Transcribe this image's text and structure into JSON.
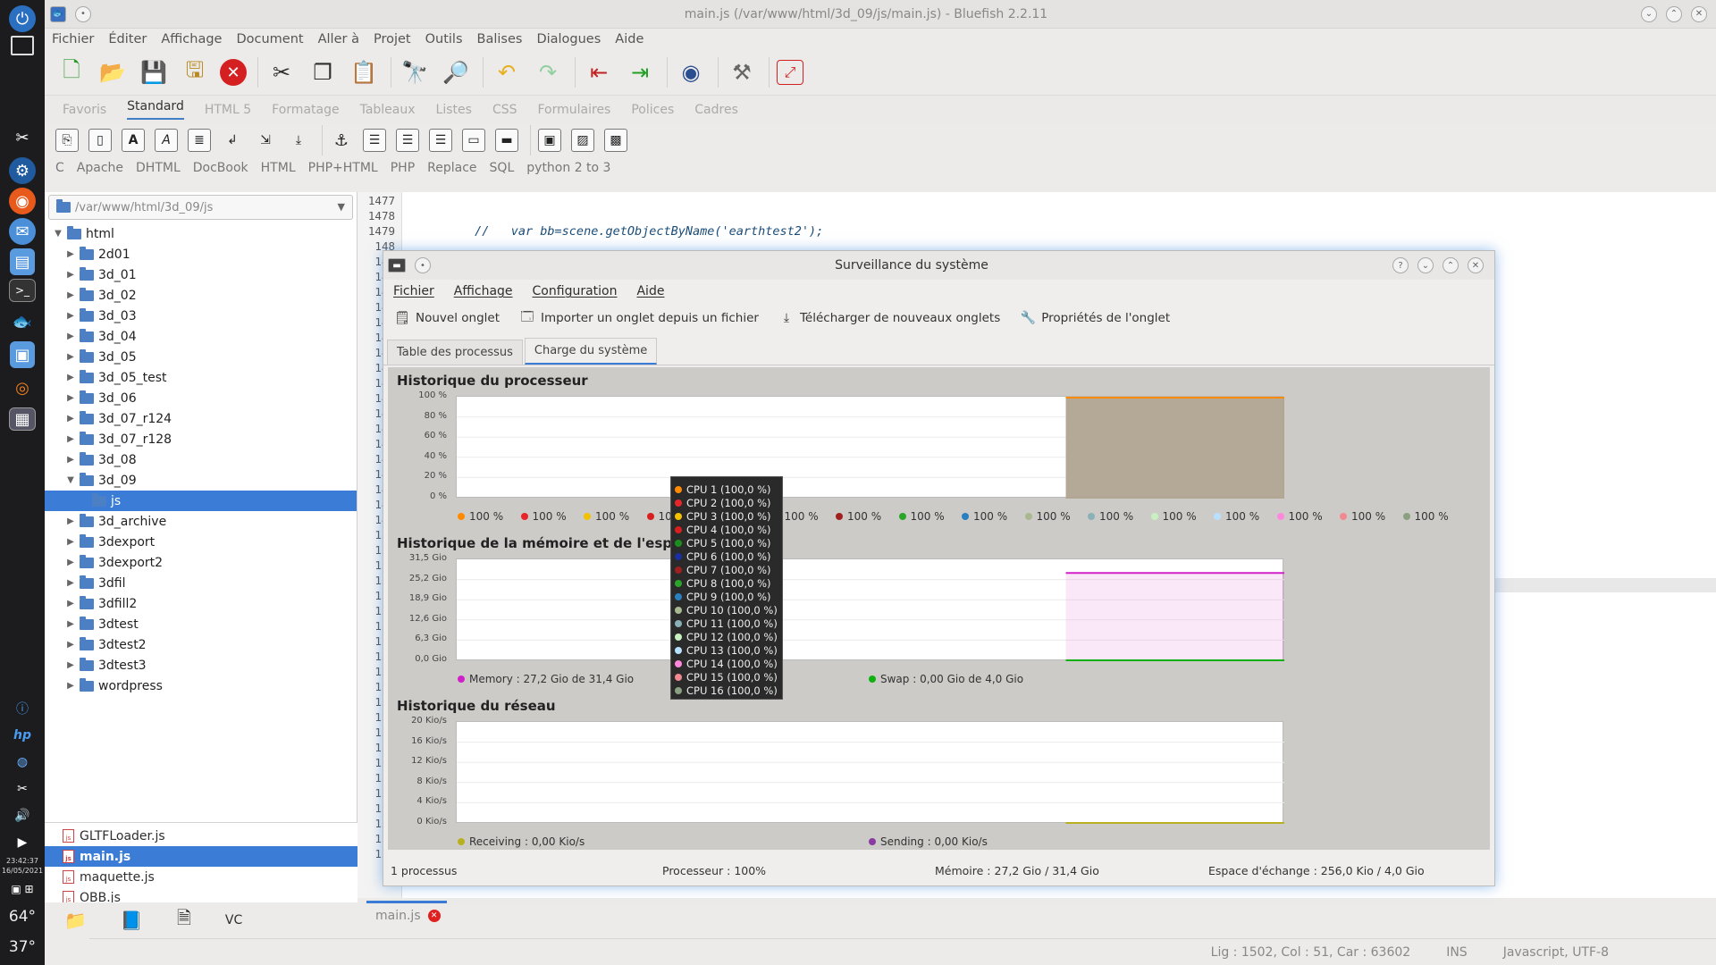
{
  "dock": {
    "clock": "23:42:37",
    "date": "16/05/2021",
    "temp1": "64°",
    "temp2": "37°"
  },
  "bluefish": {
    "title": "main.js (/var/www/html/3d_09/js/main.js) - Bluefish 2.2.11",
    "menu": [
      "Fichier",
      "Éditer",
      "Affichage",
      "Document",
      "Aller à",
      "Projet",
      "Outils",
      "Balises",
      "Dialogues",
      "Aide"
    ],
    "tabs": [
      "Favoris",
      "Standard",
      "HTML 5",
      "Formatage",
      "Tableaux",
      "Listes",
      "CSS",
      "Formulaires",
      "Polices",
      "Cadres"
    ],
    "active_tab": "Standard",
    "langs": [
      "C",
      "Apache",
      "DHTML",
      "DocBook",
      "HTML",
      "PHP+HTML",
      "PHP",
      "Replace",
      "SQL",
      "python 2 to 3"
    ],
    "path": "/var/www/html/3d_09/js",
    "tree": [
      {
        "label": "html",
        "level": 0,
        "open": true
      },
      {
        "label": "2d01",
        "level": 1
      },
      {
        "label": "3d_01",
        "level": 1
      },
      {
        "label": "3d_02",
        "level": 1
      },
      {
        "label": "3d_03",
        "level": 1
      },
      {
        "label": "3d_04",
        "level": 1
      },
      {
        "label": "3d_05",
        "level": 1
      },
      {
        "label": "3d_05_test",
        "level": 1
      },
      {
        "label": "3d_06",
        "level": 1
      },
      {
        "label": "3d_07_r124",
        "level": 1
      },
      {
        "label": "3d_07_r128",
        "level": 1
      },
      {
        "label": "3d_08",
        "level": 1
      },
      {
        "label": "3d_09",
        "level": 1,
        "open": true
      },
      {
        "label": "js",
        "level": 2,
        "selected": true
      },
      {
        "label": "3d_archive",
        "level": 1
      },
      {
        "label": "3dexport",
        "level": 1
      },
      {
        "label": "3dexport2",
        "level": 1
      },
      {
        "label": "3dfil",
        "level": 1
      },
      {
        "label": "3dfill2",
        "level": 1
      },
      {
        "label": "3dtest",
        "level": 1
      },
      {
        "label": "3dtest2",
        "level": 1
      },
      {
        "label": "3dtest3",
        "level": 1
      },
      {
        "label": "wordpress",
        "level": 1
      }
    ],
    "files": [
      {
        "label": "GLTFLoader.js"
      },
      {
        "label": "main.js",
        "selected": true
      },
      {
        "label": "maquette.js"
      },
      {
        "label": "OBB.js"
      }
    ],
    "code_lines": [
      {
        "n": "1477",
        "text": ""
      },
      {
        "n": "1478",
        "text": ""
      },
      {
        "n": "1479",
        "text": "         //   var bb=scene.getObjectByName('earthtest2');"
      },
      {
        "n": "148",
        "text": ""
      },
      {
        "n": "148",
        "text": ""
      },
      {
        "n": "148",
        "text": ""
      },
      {
        "n": "148",
        "text": ""
      },
      {
        "n": "148",
        "text": ""
      },
      {
        "n": "148",
        "text": ""
      },
      {
        "n": "148",
        "text": ""
      },
      {
        "n": "148",
        "text": ""
      },
      {
        "n": "148",
        "text": ""
      },
      {
        "n": "149",
        "text": ""
      },
      {
        "n": "149",
        "text": ""
      },
      {
        "n": "149",
        "text": ""
      },
      {
        "n": "149",
        "text": ""
      },
      {
        "n": "149",
        "text": ""
      },
      {
        "n": "149",
        "text": ""
      },
      {
        "n": "149",
        "text": ""
      },
      {
        "n": "149",
        "text": ""
      },
      {
        "n": "149",
        "text": ""
      },
      {
        "n": "149",
        "text": ""
      },
      {
        "n": "150",
        "text": ""
      },
      {
        "n": "150",
        "text": ""
      },
      {
        "n": "150",
        "text": ""
      },
      {
        "n": "150",
        "text": ""
      },
      {
        "n": "150",
        "text": ""
      },
      {
        "n": "150",
        "text": ""
      },
      {
        "n": "150",
        "text": ""
      },
      {
        "n": "150",
        "text": ""
      },
      {
        "n": "150",
        "text": ""
      },
      {
        "n": "150",
        "text": ""
      },
      {
        "n": "151",
        "text": ""
      },
      {
        "n": "151",
        "text": ""
      },
      {
        "n": "151",
        "text": ""
      },
      {
        "n": "151",
        "text": ""
      },
      {
        "n": "151",
        "text": ""
      },
      {
        "n": "151",
        "text": ""
      },
      {
        "n": "151",
        "text": ""
      },
      {
        "n": "151",
        "text": ""
      },
      {
        "n": "151",
        "text": ""
      },
      {
        "n": "151",
        "text": ""
      },
      {
        "n": "152",
        "text": ""
      },
      {
        "n": "152",
        "text": ""
      }
    ],
    "doc_tab": "main.js",
    "status": {
      "position": "Lig : 1502, Col : 51, Car : 63602",
      "mode": "INS",
      "encoding": "Javascript, UTF-8"
    }
  },
  "monitor": {
    "title": "Surveillance du système",
    "menu": [
      "Fichier",
      "Affichage",
      "Configuration",
      "Aide"
    ],
    "tools": [
      "Nouvel onglet",
      "Importer un onglet depuis un fichier",
      "Télécharger de nouveaux onglets",
      "Propriétés de l'onglet"
    ],
    "tabs": [
      "Table des processus",
      "Charge du système"
    ],
    "active_tab": "Charge du système",
    "cpu": {
      "title": "Historique du processeur",
      "yticks": [
        "100 %",
        "80 %",
        "60 %",
        "40 %",
        "20 %",
        "0 %"
      ],
      "legend": [
        "100 %",
        "100 %",
        "100 %",
        "100 %",
        "100 %",
        "100 %",
        "100 %",
        "100 %",
        "100 %",
        "100 %",
        "100 %",
        "100 %",
        "100 %",
        "100 %",
        "100 %",
        "100 %"
      ],
      "colors": [
        "#ff8a00",
        "#e8262a",
        "#f2c200",
        "#d81e1e",
        "#1d8e1d",
        "#1a2fa0",
        "#a02020",
        "#2aa52a",
        "#2a80c0",
        "#a8b890",
        "#8ab0b8",
        "#c8f0c0",
        "#b8e0ff",
        "#ff88dd",
        "#f08a90",
        "#8aa080"
      ],
      "load_fraction": 1.0
    },
    "mem": {
      "title": "Historique de la mémoire et de l'espace d'é",
      "yticks": [
        "31,5 Gio",
        "25,2 Gio",
        "18,9 Gio",
        "12,6 Gio",
        "6,3 Gio",
        "0,0 Gio"
      ],
      "memory_label": "Memory : 27,2 Gio de 31,4 Gio",
      "swap_label": "Swap : 0,00 Gio de 4,0 Gio",
      "memory_color": "#d020c8",
      "swap_color": "#10b010",
      "memory_fraction": 0.866
    },
    "net": {
      "title": "Historique du réseau",
      "yticks": [
        "20 Kio/s",
        "16 Kio/s",
        "12 Kio/s",
        "8 Kio/s",
        "4 Kio/s",
        "0 Kio/s"
      ],
      "receiving_label": "Receiving : 0,00 Kio/s",
      "sending_label": "Sending : 0,00 Kio/s",
      "receiving_color": "#b8b020",
      "sending_color": "#8a3aa0"
    },
    "tooltip": [
      "CPU 1 (100,0 %)",
      "CPU 2 (100,0 %)",
      "CPU 3 (100,0 %)",
      "CPU 4 (100,0 %)",
      "CPU 5 (100,0 %)",
      "CPU 6 (100,0 %)",
      "CPU 7 (100,0 %)",
      "CPU 8 (100,0 %)",
      "CPU 9 (100,0 %)",
      "CPU 10 (100,0 %)",
      "CPU 11 (100,0 %)",
      "CPU 12 (100,0 %)",
      "CPU 13 (100,0 %)",
      "CPU 14 (100,0 %)",
      "CPU 15 (100,0 %)",
      "CPU 16 (100,0 %)"
    ],
    "status": {
      "processes": "1 processus",
      "cpu": "Processeur : 100%",
      "memory": "Mémoire : 27,2 Gio / 31,4 Gio",
      "swap": "Espace d'échange : 256,0 Kio / 4,0 Gio"
    }
  }
}
